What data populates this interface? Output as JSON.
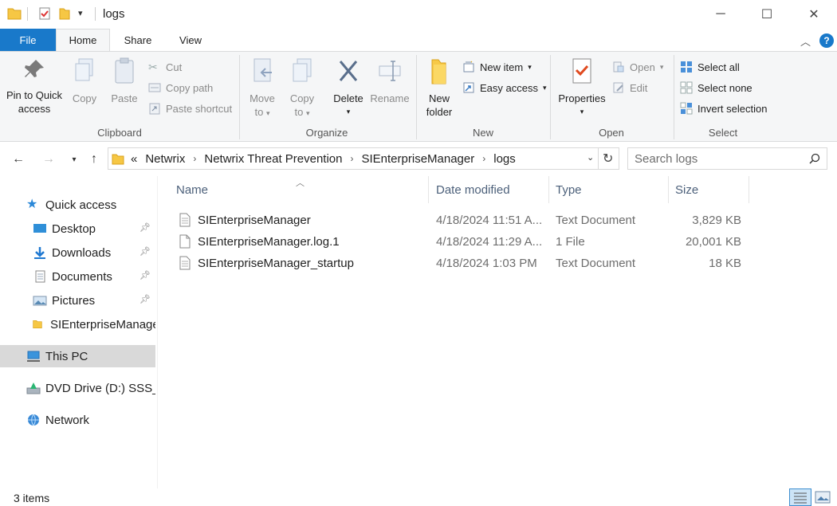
{
  "window": {
    "title": "logs",
    "controls": {
      "minimize": "─",
      "maximize": "☐",
      "close": "✕"
    }
  },
  "ribbon": {
    "tabs": [
      "File",
      "Home",
      "Share",
      "View"
    ],
    "active_tab": "Home",
    "clipboard": {
      "label": "Clipboard",
      "pin_label_1": "Pin to Quick",
      "pin_label_2": "access",
      "copy": "Copy",
      "paste": "Paste",
      "cut": "Cut",
      "copy_path": "Copy path",
      "paste_shortcut": "Paste shortcut"
    },
    "organize": {
      "label": "Organize",
      "move_to_1": "Move",
      "move_to_2": "to",
      "copy_to_1": "Copy",
      "copy_to_2": "to",
      "delete": "Delete",
      "rename": "Rename"
    },
    "new": {
      "label": "New",
      "new_folder_1": "New",
      "new_folder_2": "folder",
      "new_item": "New item",
      "easy_access": "Easy access"
    },
    "open": {
      "label": "Open",
      "properties": "Properties",
      "open": "Open",
      "edit": "Edit"
    },
    "select": {
      "label": "Select",
      "select_all": "Select all",
      "select_none": "Select none",
      "invert_selection": "Invert selection"
    }
  },
  "address": {
    "overflow": "«",
    "crumbs": [
      "Netwrix",
      "Netwrix Threat Prevention",
      "SIEnterpriseManager",
      "logs"
    ],
    "search_placeholder": "Search logs"
  },
  "nav_pane": {
    "quick_access": "Quick access",
    "items": [
      "Desktop",
      "Downloads",
      "Documents",
      "Pictures",
      "SIEnterpriseManager"
    ],
    "this_pc": "This PC",
    "dvd_drive": "DVD Drive (D:) SSS_X",
    "network": "Network"
  },
  "columns": {
    "name": "Name",
    "date_modified": "Date modified",
    "type": "Type",
    "size": "Size"
  },
  "files": [
    {
      "name": "SIEnterpriseManager",
      "date": "4/18/2024 11:51 A...",
      "type": "Text Document",
      "size": "3,829 KB"
    },
    {
      "name": "SIEnterpriseManager.log.1",
      "date": "4/18/2024 11:29 A...",
      "type": "1 File",
      "size": "20,001 KB"
    },
    {
      "name": "SIEnterpriseManager_startup",
      "date": "4/18/2024 1:03 PM",
      "type": "Text Document",
      "size": "18 KB"
    }
  ],
  "status": {
    "item_count": "3 items"
  },
  "colors": {
    "accent": "#1979ca",
    "ribbon_bg": "#f5f6f7",
    "header_text": "#4c607a",
    "selected": "#d9d9d9"
  }
}
